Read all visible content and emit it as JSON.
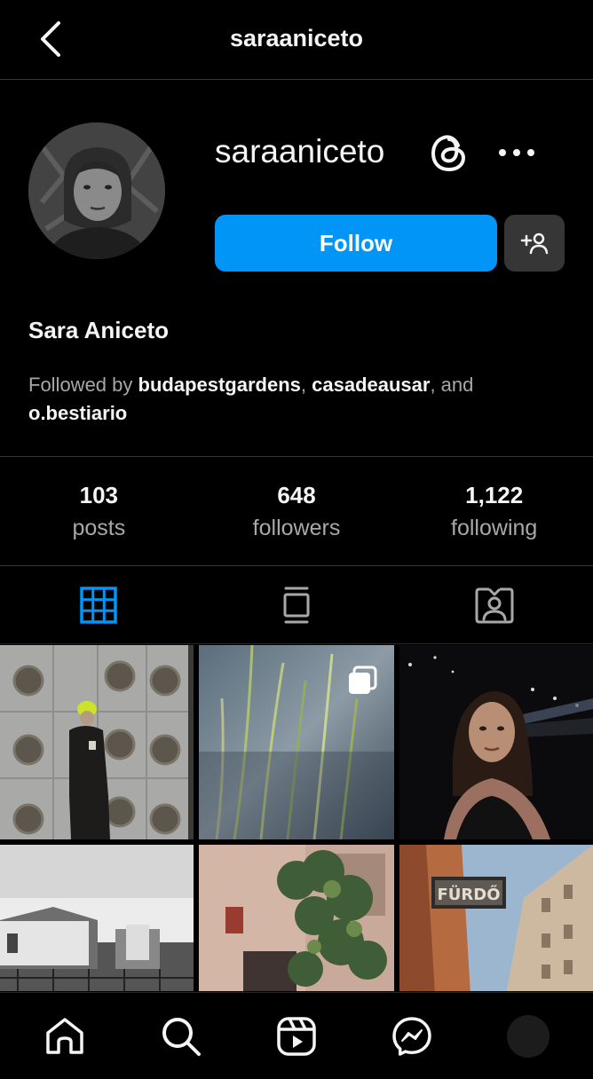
{
  "header": {
    "title": "saraaniceto",
    "back_icon": "chevron-left-icon"
  },
  "profile": {
    "username": "saraaniceto",
    "full_name": "Sara Aniceto",
    "follow_label": "Follow",
    "followed_by": {
      "prefix": "Followed by ",
      "user1": "budapestgardens",
      "sep1": ", ",
      "user2": "casadeausar",
      "sep2": ", and ",
      "user3": "o.bestiario"
    }
  },
  "stats": [
    {
      "value": "103",
      "label": "posts"
    },
    {
      "value": "648",
      "label": "followers"
    },
    {
      "value": "1,122",
      "label": "following"
    }
  ],
  "tabs": [
    {
      "name": "posts-grid",
      "icon": "grid-icon",
      "active": true
    },
    {
      "name": "feed",
      "icon": "feed-icon",
      "active": false
    },
    {
      "name": "tagged",
      "icon": "tagged-icon",
      "active": false
    }
  ],
  "colors": {
    "accent": "#0095f6",
    "background": "#000000",
    "secondary_text": "#a8a8a8",
    "active_tab": "#0095f6",
    "button_secondary": "#363636"
  },
  "grid_posts": [
    {
      "multi": false
    },
    {
      "multi": true
    },
    {
      "multi": false
    },
    {
      "multi": false
    },
    {
      "multi": false
    },
    {
      "multi": false
    }
  ],
  "bottom_nav": [
    "home-icon",
    "search-icon",
    "reels-icon",
    "messenger-icon",
    "profile-avatar"
  ]
}
